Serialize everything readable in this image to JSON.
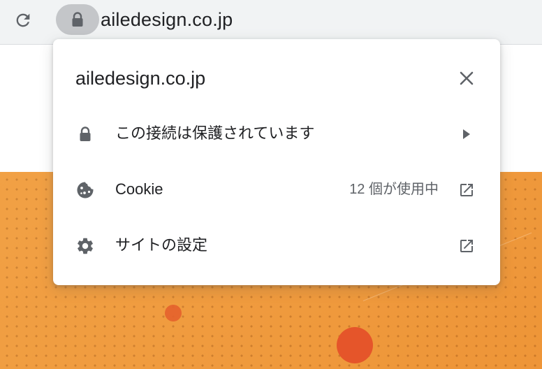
{
  "browser": {
    "url": "ailedesign.co.jp"
  },
  "popup": {
    "title": "ailedesign.co.jp",
    "rows": [
      {
        "label": "この接続は保護されています",
        "icon": "lock-icon",
        "trail_icon": "arrow-right-icon"
      },
      {
        "label": "Cookie",
        "value": "12 個が使用中",
        "icon": "cookie-icon",
        "trail_icon": "open-external-icon"
      },
      {
        "label": "サイトの設定",
        "icon": "gear-icon",
        "trail_icon": "open-external-icon"
      }
    ]
  },
  "colors": {
    "icon": "#5f6368",
    "text": "#202124",
    "toolbar": "#f1f3f4",
    "page_orange": "#ef9a3c"
  }
}
